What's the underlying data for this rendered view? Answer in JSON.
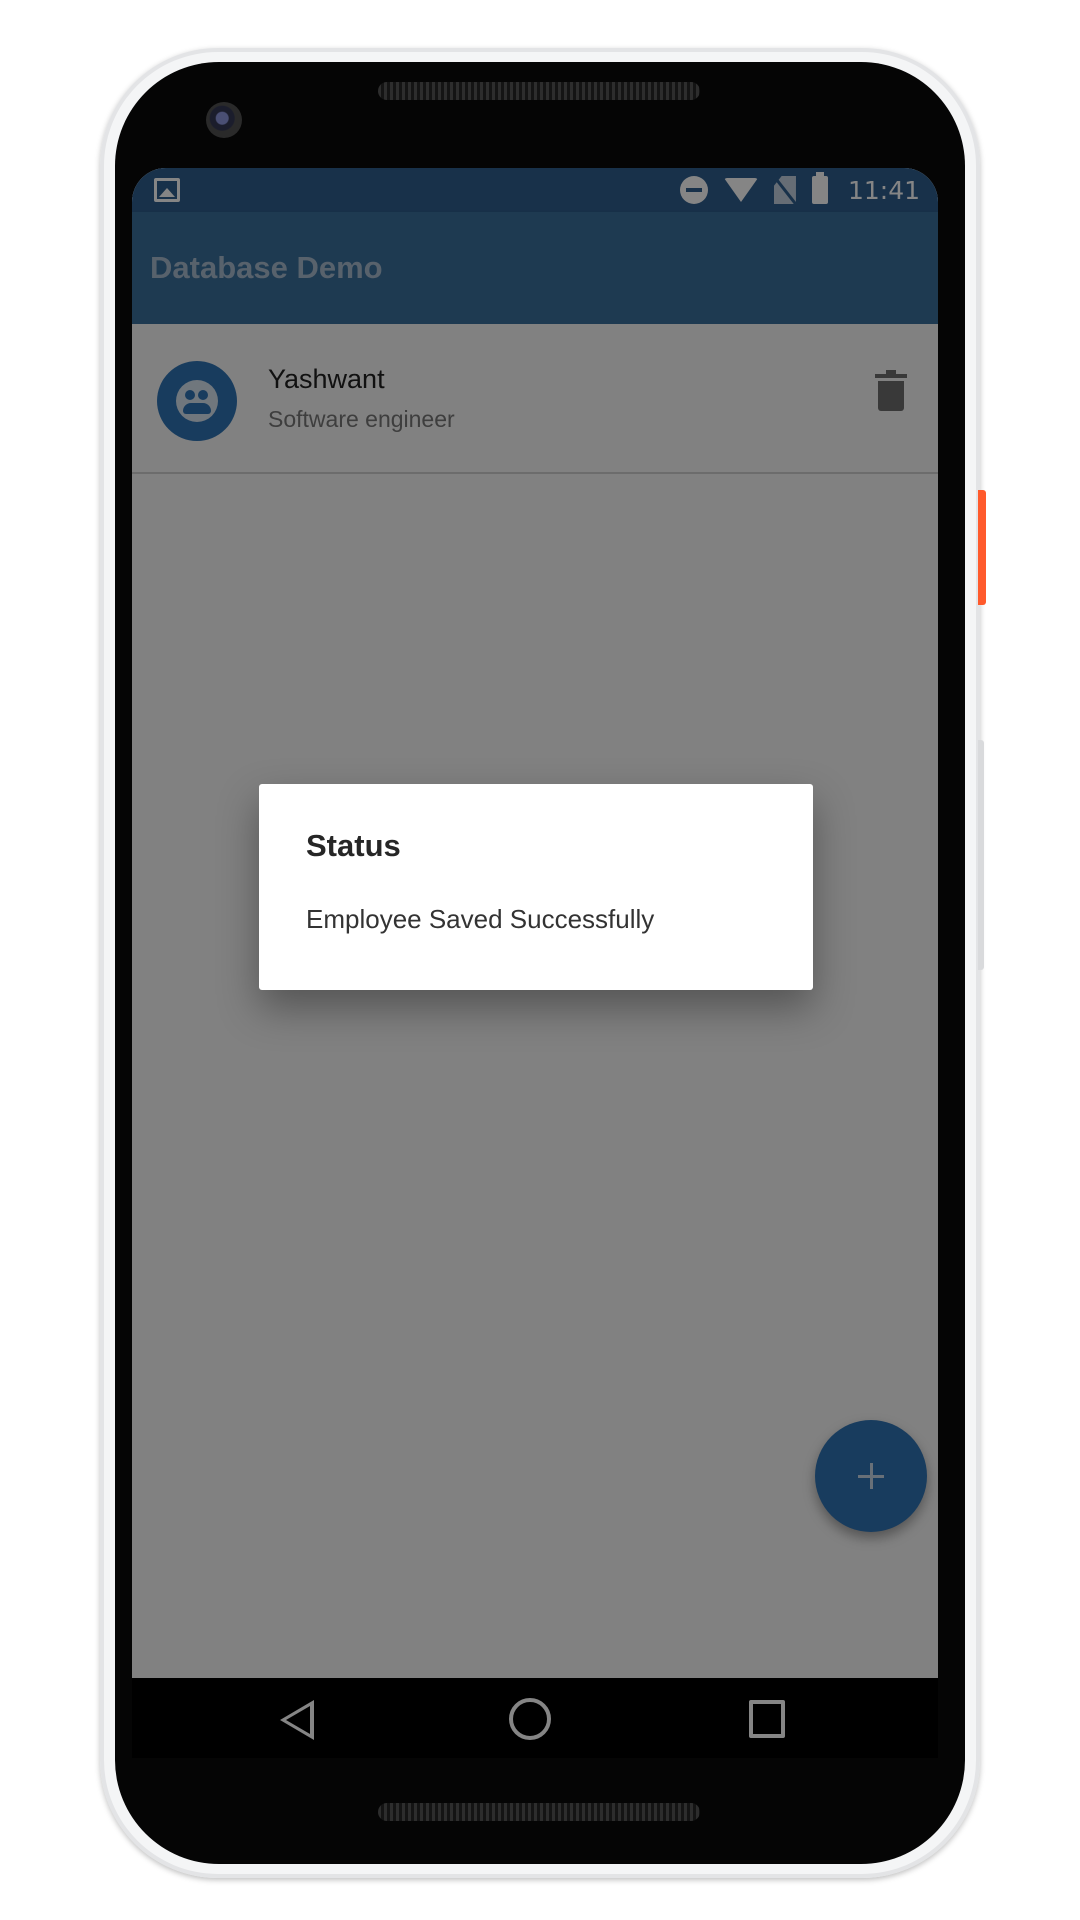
{
  "status_bar": {
    "time": "11:41",
    "icons": [
      "gallery-icon",
      "do-not-disturb-icon",
      "wifi-icon",
      "no-sim-icon",
      "battery-icon"
    ]
  },
  "app_bar": {
    "title": "Database Demo",
    "color": "#3b6f9c"
  },
  "employees": [
    {
      "name": "Yashwant",
      "role": "Software engineer",
      "avatar_icon": "people-icon",
      "action_icon": "trash-icon"
    }
  ],
  "dialog": {
    "title": "Status",
    "message": "Employee Saved Successfully"
  },
  "fab": {
    "icon": "plus-icon",
    "color": "#2f73b4"
  },
  "nav_bar": {
    "buttons": [
      "back-icon",
      "home-icon",
      "recents-icon"
    ]
  },
  "device": {
    "accent_key_color": "#ff5a2c"
  }
}
